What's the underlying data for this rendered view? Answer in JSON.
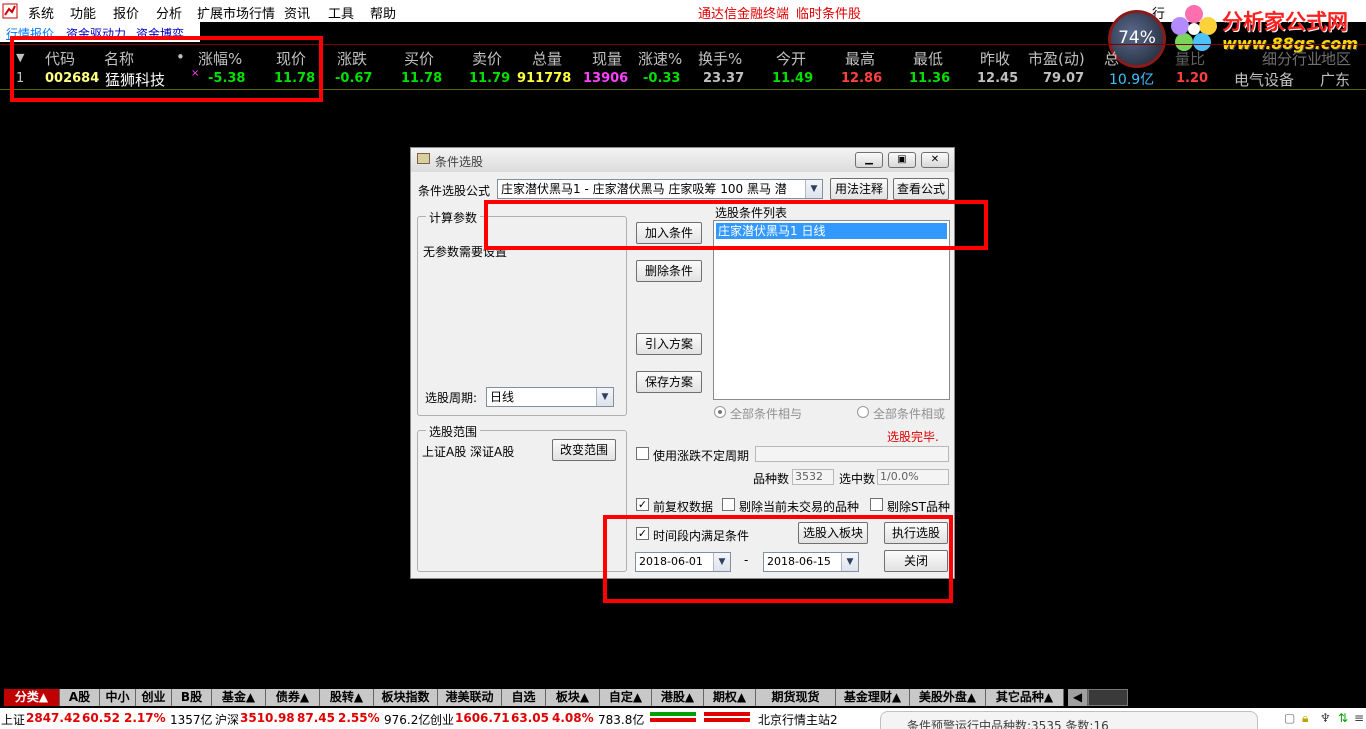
{
  "menubar": {
    "items": [
      "系统",
      "功能",
      "报价",
      "分析",
      "扩展市场行情",
      "资讯",
      "工具",
      "帮助"
    ],
    "title": "通达信金融终端",
    "subtitle": "临时条件股",
    "right_fragment": "行"
  },
  "tabs": [
    "行情报价",
    "资金驱动力",
    "资金博弈"
  ],
  "watermark": {
    "percent": "74%",
    "brand": "分析家公式网",
    "url": "www.88gs.com"
  },
  "quote_table": {
    "headers": [
      "代码",
      "名称",
      "•",
      "涨幅%",
      "现价",
      "涨跌",
      "买价",
      "卖价",
      "总量",
      "现量",
      "涨速%",
      "换手%",
      "今开",
      "最高",
      "最低",
      "昨收",
      "市盈(动)",
      "总",
      "量比",
      "细分行业",
      "地区"
    ],
    "row": {
      "index": "1",
      "code": "002684",
      "name": "猛狮科技",
      "mark": "×",
      "change_pct": "-5.38",
      "price": "11.78",
      "change": "-0.67",
      "bid": "11.78",
      "ask": "11.79",
      "volume": "911778",
      "cur_volume": "13906",
      "speed": "-0.33",
      "turnover": "23.37",
      "open": "11.49",
      "high": "12.86",
      "low": "11.36",
      "prev_close": "12.45",
      "pe": "79.07",
      "total": "10.9亿",
      "vol_ratio": "1.20",
      "industry": "电气设备",
      "region": "广东"
    }
  },
  "dialog": {
    "title": "条件选股",
    "formula_label": "条件选股公式",
    "formula_value": "庄家潜伏黑马1 - 庄家潜伏黑马  庄家吸筹 100  黑马 潜",
    "usage_btn": "用法注释",
    "view_formula_btn": "查看公式",
    "calc_params_title": "计算参数",
    "no_params_text": "无参数需要设置",
    "period_label": "选股周期:",
    "period_value": "日线",
    "add_btn": "加入条件",
    "delete_btn": "删除条件",
    "import_btn": "引入方案",
    "save_btn": "保存方案",
    "condition_list_label": "选股条件列表",
    "condition_item": "庄家潜伏黑马1   日线",
    "radio_and": "全部条件相与",
    "radio_or": "全部条件相或",
    "status": "选股完毕.",
    "range_title": "选股范围",
    "range_value": "上证A股  深证A股",
    "change_range_btn": "改变范围",
    "use_period_label": "使用涨跌不定周期",
    "stock_count_label": "品种数",
    "stock_count_value": "3532",
    "selected_label": "选中数",
    "selected_value": "1/0.0%",
    "pre_adjust_label": "前复权数据",
    "exclude_untraded_label": "剔除当前未交易的品种",
    "exclude_st_label": "剔除ST品种",
    "time_range_label": "时间段内满足条件",
    "to_block_btn": "选股入板块",
    "execute_btn": "执行选股",
    "close_btn": "关闭",
    "date_from": "2018-06-01",
    "date_sep": "-",
    "date_to": "2018-06-15"
  },
  "bottom_tabs": [
    "分类▲",
    "A股",
    "中小",
    "创业",
    "B股",
    "基金▲",
    "债券▲",
    "股转▲",
    "板块指数",
    "港美联动",
    "自选",
    "板块▲",
    "自定▲",
    "港股▲",
    "期权▲",
    "期货现货",
    "基金理财▲",
    "美股外盘▲",
    "其它品种▲"
  ],
  "statusbar": {
    "sh_label": "上证",
    "sh_value": "2847.42",
    "sh_change": "60.52",
    "sh_pct": "2.17%",
    "sh_amount": "1357亿",
    "hs_label": "沪深",
    "hs_value": "3510.98",
    "hs_change": "87.45",
    "hs_pct": "2.55%",
    "hs_amount": "976.2亿",
    "cy_label": "创业",
    "cy_value": "1606.71",
    "cy_change": "63.05",
    "cy_pct": "4.08%",
    "cy_amount": "783.8亿",
    "server": "北京行情主站2",
    "notice": "条件预警运行中品种数:3535 条数:16"
  },
  "colors": {
    "up": "#ff3030",
    "down": "#00e000",
    "highlight_box": "#ff0000"
  }
}
